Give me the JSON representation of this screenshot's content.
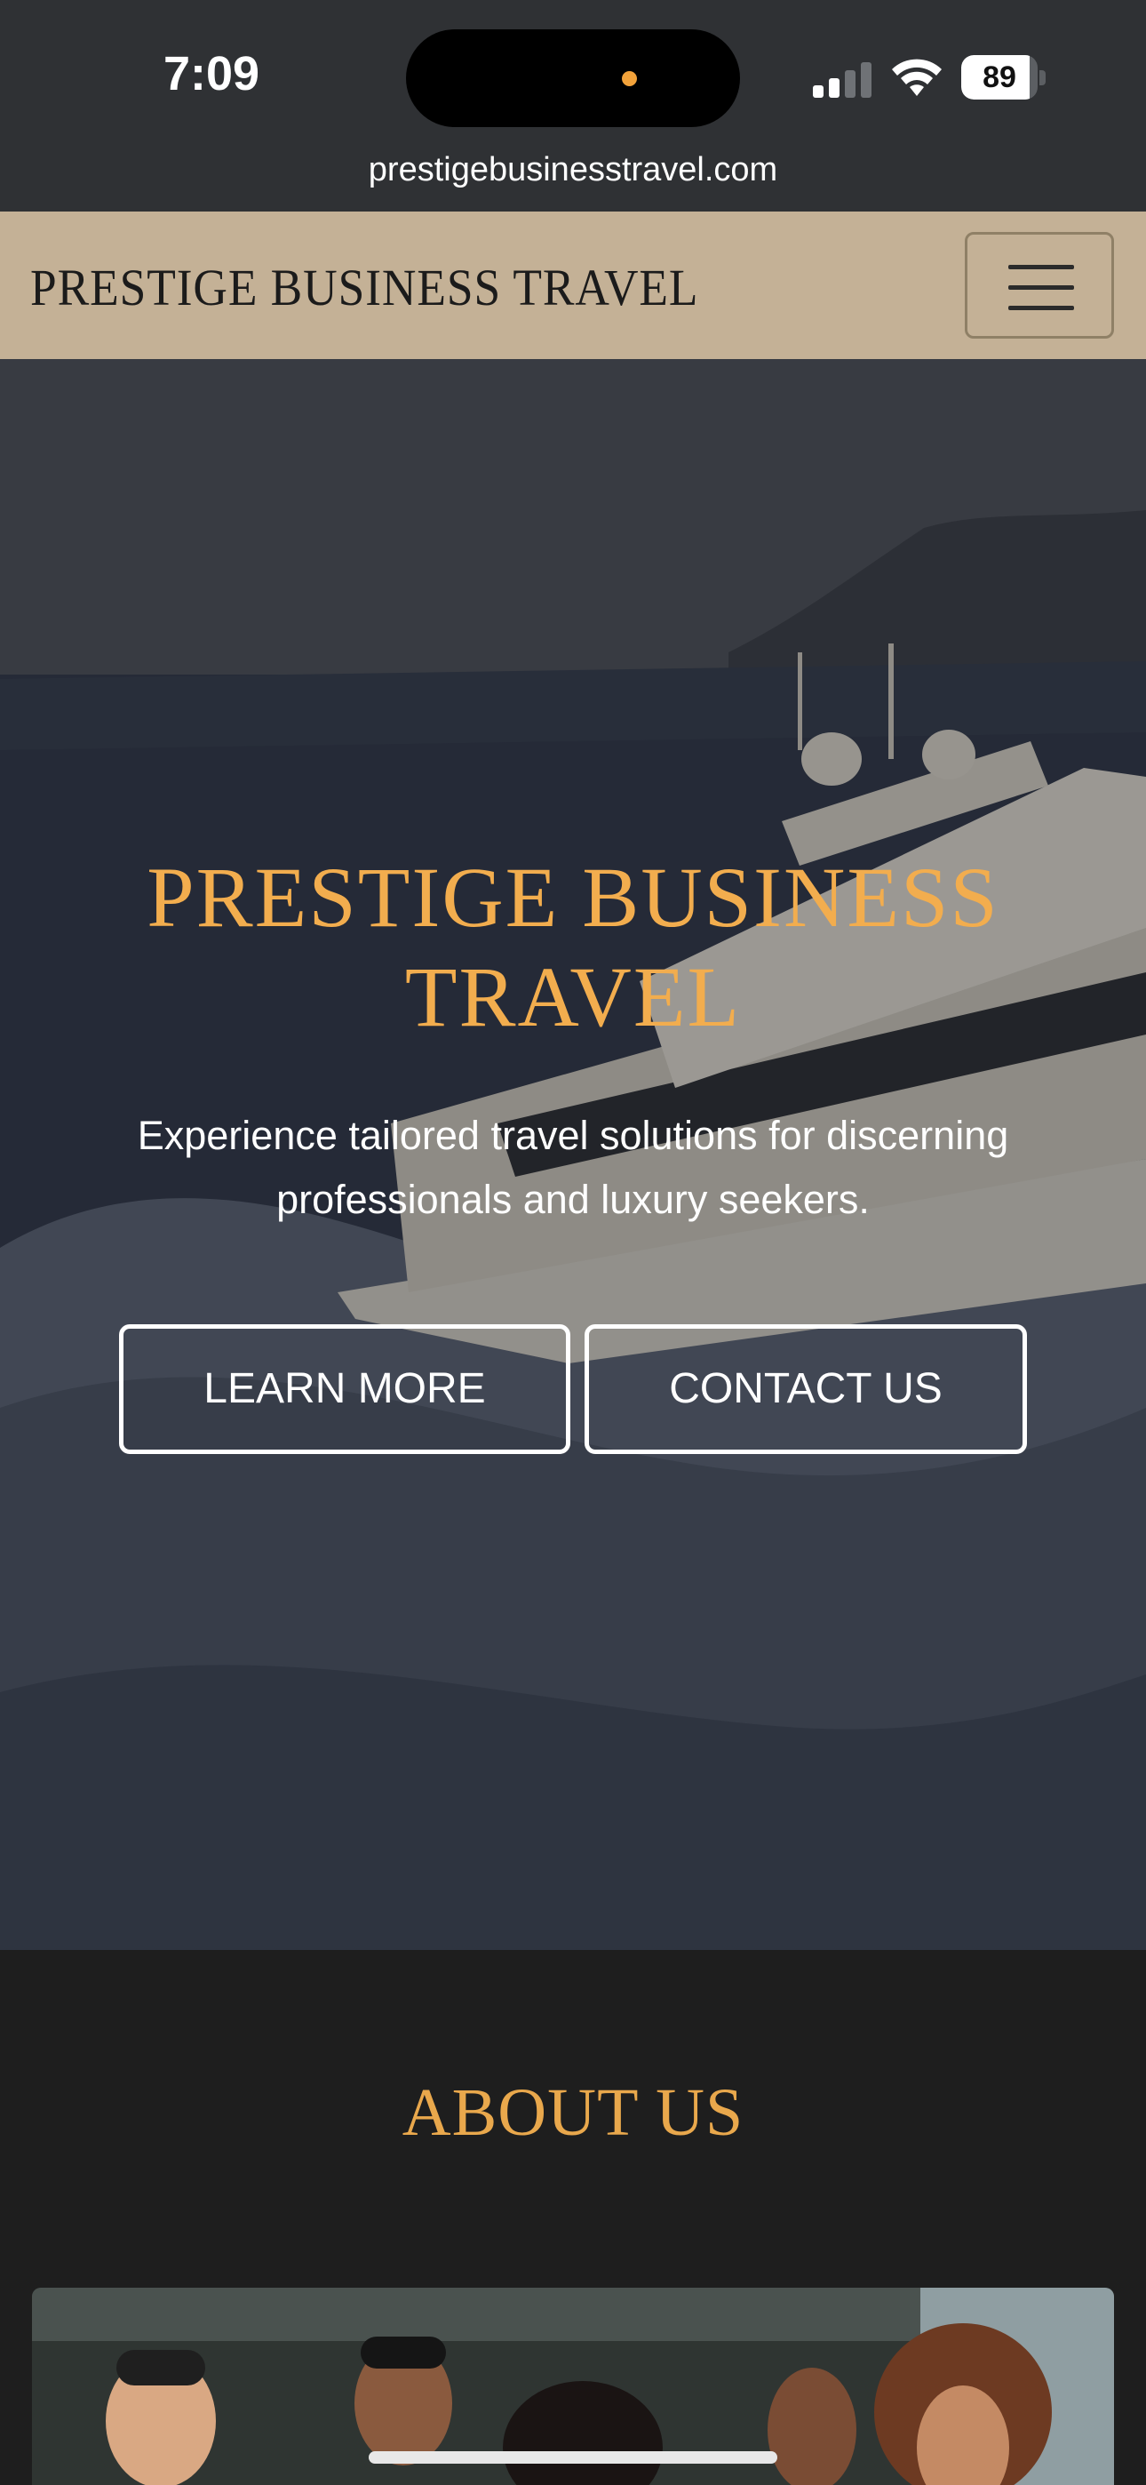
{
  "status_bar": {
    "time": "7:09",
    "battery_percent": "89",
    "battery_level": 0.89,
    "signal_icon": "cellular-signal-icon",
    "wifi_icon": "wifi-icon"
  },
  "browser": {
    "url": "prestigebusinesstravel.com"
  },
  "navbar": {
    "brand": "PRESTIGE BUSINESS TRAVEL",
    "menu_icon": "hamburger-menu-icon",
    "background": "#c4b196"
  },
  "hero": {
    "title": "PRESTIGE BUSINESS TRAVEL",
    "subtitle": "Experience tailored travel solutions for discerning professionals and luxury seekers.",
    "learn_more_label": "LEARN MORE",
    "contact_label": "CONTACT US",
    "title_color": "#f2ad4e"
  },
  "about": {
    "title": "ABOUT US",
    "title_color": "#e9a84c"
  }
}
